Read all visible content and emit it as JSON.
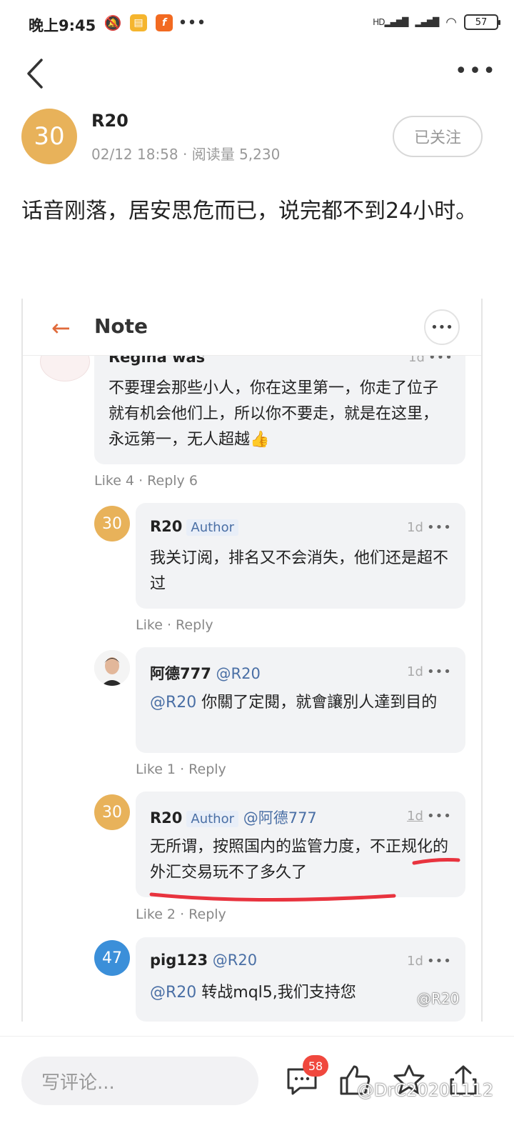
{
  "status_bar": {
    "time": "晚上9:45",
    "signal_label": "HD",
    "battery": "57"
  },
  "post": {
    "avatar_text": "30",
    "author": "R20",
    "meta": "02/12 18:58 · 阅读量 5,230",
    "follow_label": "已关注",
    "body": "话音刚落，居安思危而已，说完都不到24小时。"
  },
  "embed": {
    "header_title": "Note",
    "comments": [
      {
        "author": "Regina was",
        "time": "1d",
        "text": "不要理会那些小人，你在这里第一，你走了位子就有机会他们上，所以你不要走，就是在这里，永远第一，无人超越👍",
        "like": "Like 4",
        "reply": "Reply 6"
      },
      {
        "avatar": "30",
        "author": "R20",
        "tag": "Author",
        "time": "1d",
        "text": "我关订阅，排名又不会消失，他们还是超不过",
        "like": "Like",
        "reply": "Reply"
      },
      {
        "author": "阿德777",
        "mention": "@R20",
        "time": "1d",
        "text_mention": "@R20",
        "text": " 你關了定閱，就會讓別人達到目的",
        "like": "Like 1",
        "reply": "Reply"
      },
      {
        "avatar": "30",
        "author": "R20",
        "tag": "Author",
        "mention": "@阿德777",
        "time": "1d",
        "text": "无所谓，按照国内的监管力度，不正规化的外汇交易玩不了多久了",
        "like": "Like 2",
        "reply": "Reply"
      },
      {
        "avatar": "47",
        "author": "pig123",
        "mention": "@R20",
        "time": "1d",
        "text_mention": "@R20",
        "text": " 转战mql5,我们支持您"
      }
    ],
    "watermark": "@R20"
  },
  "bottom_bar": {
    "comment_placeholder": "写评论...",
    "comment_count": "58",
    "watermark": "@DrC20201112"
  },
  "colors": {
    "avatar_yellow": "#e8b25a",
    "avatar_blue": "#3b8fd9",
    "mention": "#4a6fa5",
    "badge": "#f0483e",
    "accent_orange": "#e06a3a",
    "underline_red": "#e8333e"
  }
}
